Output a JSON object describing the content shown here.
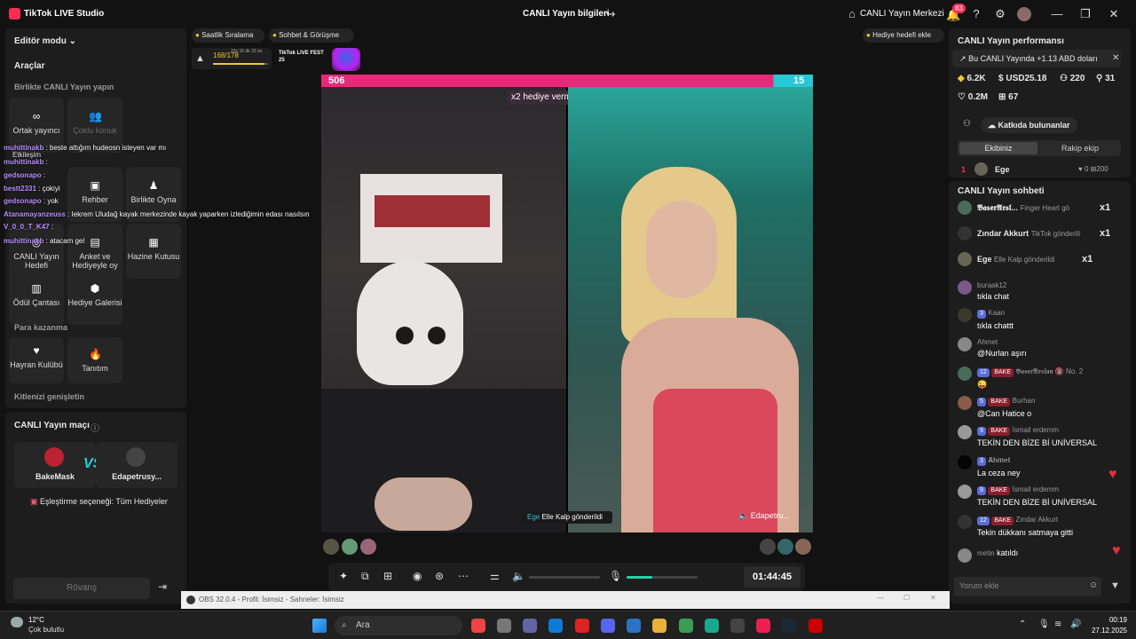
{
  "titlebar": {
    "app": "TikTok LIVE Studio",
    "center": "CANLI Yayın bilgileri",
    "center_right": "CANLI Yayın Merkezi",
    "notif_count": "83"
  },
  "left": {
    "editor_mode": "Editör modu",
    "tools": "Araçlar",
    "live_together": "Birlikte CANLI Yayın yapın",
    "cohost": "Ortak yayıncı",
    "multi_guest": "Çoklu konuk",
    "interaction": "Etkileşim",
    "guide": "Rehber",
    "play_together": "Birlikte Oyna",
    "live_goal": "CANLI Yayın Hedefi",
    "poll": "Anket ve Hediyeyle oy",
    "treasure": "Hazine Kutusu",
    "reward_bag": "Ödül Çantası",
    "gift_gallery": "Hediye Galerisi",
    "monetize": "Para kazanma",
    "fan_club": "Hayran Kulübü",
    "promo": "Tanıtım",
    "expand": "Kitlenizi genişletin",
    "match_title": "CANLI Yayın maçı",
    "player1": "BakeMask",
    "player2": "Edapetrusy...",
    "match_option": "Eşleştirme seçeneği: Tüm Hediyeler",
    "rematch": "Rövanş"
  },
  "overlay_chat": [
    {
      "user": "muhittinakb",
      "msg": ": beste attığım hudeosn isteyen var mı"
    },
    {
      "user": "muhittinakb",
      "msg": ":"
    },
    {
      "user": "gedsonapo",
      "msg": ":"
    },
    {
      "user": "bestt2331",
      "msg": ": çokiyi"
    },
    {
      "user": "gedsonapo",
      "msg": ": yok"
    },
    {
      "user": "Atanamayanzeuss",
      "msg": ": Iekrem Uludağ kayak merkezinde kayak yaparken izlediğimin edası nasılsın"
    },
    {
      "user": "V_0_0_T_K47",
      "msg": ":"
    },
    {
      "user": "muhittinakb",
      "msg": ": atacam gel"
    }
  ],
  "top_tags": {
    "hourly": "Saatlik Sıralama",
    "chat": "Sohbet & Görüşme",
    "gift_goal": "Hediye hedefi ekle",
    "progress": "168/178",
    "timer": "23s 15 dk 22 sn",
    "fest": "TikTok LIVE FEST 25"
  },
  "battle": {
    "score_left": "506",
    "score_right": "15",
    "multiplier": "x2 hediye verme puanı",
    "mult_timer": "11s",
    "gift_user": "Ege",
    "gift_msg": "Elle Kalp gönderildi",
    "opponent": "Edapetru..."
  },
  "controls": {
    "timer": "01:44:45"
  },
  "right": {
    "perf_title": "CANLI Yayın performansı",
    "banner": "Bu CANLI Yayında +1.13 ABD doları",
    "diamonds": "6.2K",
    "usd": "USD25.18",
    "viewers": "220",
    "new_followers": "31",
    "likes": "0.2M",
    "gifters": "67",
    "contributors": "Katkıda bulunanlar",
    "tab_ours": "Ekibiniz",
    "tab_rival": "Rakip ekip",
    "rank_num": "1",
    "rank_name": "Ege",
    "rank_score": "0",
    "rank_score2": "200"
  },
  "chat": {
    "title": "CANLI Yayın sohbeti",
    "gifts": [
      {
        "name": "𝕭𝖆𝖘𝖊𝖗𝕬𝖗𝖘𝖑...",
        "msg": "Finger Heart gö",
        "count": "x1"
      },
      {
        "name": "Zındar Akkurt",
        "msg": "TikTok gönderili",
        "count": "x1"
      },
      {
        "name": "Ege",
        "msg": "Elle Kalp gönderildi",
        "count": "x1"
      }
    ],
    "messages": [
      {
        "lvl": "",
        "bake": "",
        "name": "buraak12",
        "msg": "tıkla chat"
      },
      {
        "lvl": "3",
        "bake": "",
        "name": "Kaan",
        "msg": "tıkla chattt"
      },
      {
        "lvl": "",
        "bake": "",
        "name": "Ahmet",
        "msg": "@Nurlan aşırı"
      },
      {
        "lvl": "12",
        "bake": "BAKE",
        "name": "𝕭𝖆𝖘𝖊𝖗𝕬𝖗𝖘𝖑𝖆𝖓 🔞 No. 2",
        "msg": "😜"
      },
      {
        "lvl": "5",
        "bake": "BAKE",
        "name": "Burhan",
        "msg": "@Can Hatice o"
      },
      {
        "lvl": "9",
        "bake": "BAKE",
        "name": "İsmail erdemm",
        "msg": "TEKİN DEN BİZE Bİ UNİVERSAL"
      },
      {
        "lvl": "3",
        "bake": "",
        "name": "𝐀𝐡𝐦𝐞𝐭",
        "msg": "La ceza ney"
      },
      {
        "lvl": "9",
        "bake": "BAKE",
        "name": "İsmail erdemm",
        "msg": "TEKİN DEN BİZE Bİ UNİVERSAL"
      },
      {
        "lvl": "12",
        "bake": "BAKE",
        "name": "Zındar Akkurt",
        "msg": "Tekin dükkanı satmaya gitti"
      }
    ],
    "joined_user": "metin",
    "joined": "katıldı",
    "input_placeholder": "Yorum ekle"
  },
  "obs": {
    "title": "OBS 32.0.4 - Profil: İsimsiz - Sahneler: İsimsiz"
  },
  "taskbar": {
    "temp": "12°C",
    "weather": "Çok bulutlu",
    "search": "Ara",
    "time": "00:19",
    "date": "27.12.2025"
  }
}
